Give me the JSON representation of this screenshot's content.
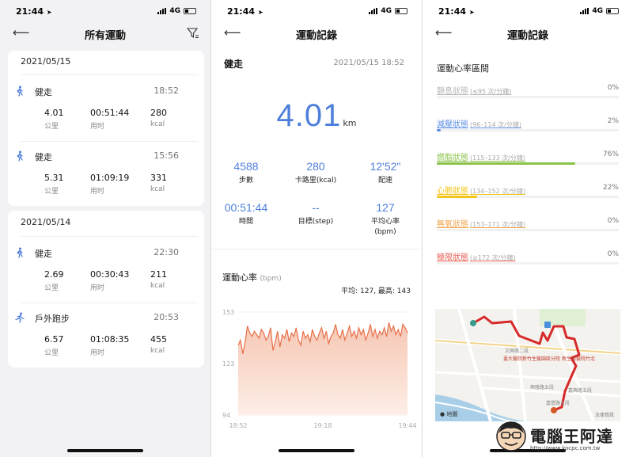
{
  "status": {
    "time": "21:44",
    "network": "4G"
  },
  "panel1": {
    "title": "所有運動",
    "groups": [
      {
        "date": "2021/05/15",
        "activities": [
          {
            "icon": "walk-icon",
            "name": "健走",
            "time": "18:52",
            "distance": "4.01",
            "duration": "00:51:44",
            "calories": "280"
          },
          {
            "icon": "walk-icon",
            "name": "健走",
            "time": "15:56",
            "distance": "5.31",
            "duration": "01:09:19",
            "calories": "331"
          }
        ]
      },
      {
        "date": "2021/05/14",
        "activities": [
          {
            "icon": "walk-icon",
            "name": "健走",
            "time": "22:30",
            "distance": "2.69",
            "duration": "00:30:43",
            "calories": "211"
          },
          {
            "icon": "run-icon",
            "name": "戶外跑步",
            "time": "20:53",
            "distance": "6.57",
            "duration": "01:08:35",
            "calories": "455"
          }
        ]
      }
    ],
    "units": {
      "distance": "公里",
      "duration": "用时",
      "calories": "kcal"
    }
  },
  "panel2": {
    "title": "運動記錄",
    "activity": "健走",
    "datetime": "2021/05/15 18:52",
    "distance": "4.01",
    "distance_unit": "km",
    "stats": [
      {
        "value": "4588",
        "label": "步數"
      },
      {
        "value": "280",
        "label": "卡路里(kcal)"
      },
      {
        "value": "12'52\"",
        "label": "配速"
      },
      {
        "value": "00:51:44",
        "label": "時間"
      },
      {
        "value": "--",
        "label": "目標(step)"
      },
      {
        "value": "127",
        "label": "平均心率\n(bpm)"
      }
    ],
    "hr_title": "運動心率",
    "hr_unit": "(bpm)",
    "hr_summary": "平均: 127,  最高: 143"
  },
  "chart_data": {
    "type": "area",
    "title": "運動心率",
    "ylabel": "(bpm)",
    "ylim": [
      94,
      153
    ],
    "yticks": [
      "153",
      "123",
      "94"
    ],
    "xticks": [
      "18:52",
      "19:18",
      "19:44"
    ],
    "series": [
      {
        "values": [
          134,
          137,
          129,
          136,
          145,
          141,
          139,
          142,
          140,
          138,
          143,
          141,
          137,
          139,
          144,
          131,
          136,
          142,
          133,
          140,
          138,
          143,
          136,
          141,
          139,
          144,
          137,
          134,
          142,
          138,
          140,
          136,
          143,
          139,
          137,
          141,
          144,
          138,
          142,
          135,
          139,
          141,
          146,
          140,
          138,
          143,
          137,
          141,
          145,
          139,
          142,
          138,
          144,
          140,
          143,
          137,
          141,
          146,
          139,
          143,
          138,
          142,
          140,
          144,
          139,
          147,
          142,
          145,
          140,
          143,
          139,
          146,
          144,
          141
        ]
      }
    ]
  },
  "panel3": {
    "title": "運動記錄",
    "zones_title": "運動心率區間",
    "zones": [
      {
        "name": "靜息狀態",
        "range": "(≤95 次/分鐘)",
        "percent": "0%",
        "fraction": 0.0,
        "color": "#b7b7b7"
      },
      {
        "name": "減壓狀態",
        "range": "(96–114 次/分鐘)",
        "percent": "2%",
        "fraction": 0.02,
        "color": "#5b8ee6"
      },
      {
        "name": "燃脂狀態",
        "range": "(115–133 次/分鐘)",
        "percent": "76%",
        "fraction": 0.76,
        "color": "#8bc34a"
      },
      {
        "name": "心肺狀態",
        "range": "(134–152 次/分鐘)",
        "percent": "22%",
        "fraction": 0.22,
        "color": "#f2c51a"
      },
      {
        "name": "無氧狀態",
        "range": "(153–171 次/分鐘)",
        "percent": "0%",
        "fraction": 0.0,
        "color": "#f0a248"
      },
      {
        "name": "極限狀態",
        "range": "(≥172 次/分鐘)",
        "percent": "0%",
        "fraction": 0.0,
        "color": "#ec5b4f"
      }
    ],
    "map": {
      "labels": [
        "文興路二段",
        "臺大醫院新竹生醫園區分院",
        "新生醫醫院竹北",
        "興隆路五段",
        "嘉興路五段",
        "嘉豐路五段"
      ],
      "logo": "地圖",
      "legal": "法律資訊"
    }
  },
  "watermark": {
    "name": "電腦王阿達",
    "url": "http://www.kocpc.com.tw"
  },
  "colors": {
    "accent": "#4f7fdc",
    "chart_line": "#e8704a",
    "chart_fill": "#f6c7b4",
    "route": "#d62a2a"
  }
}
